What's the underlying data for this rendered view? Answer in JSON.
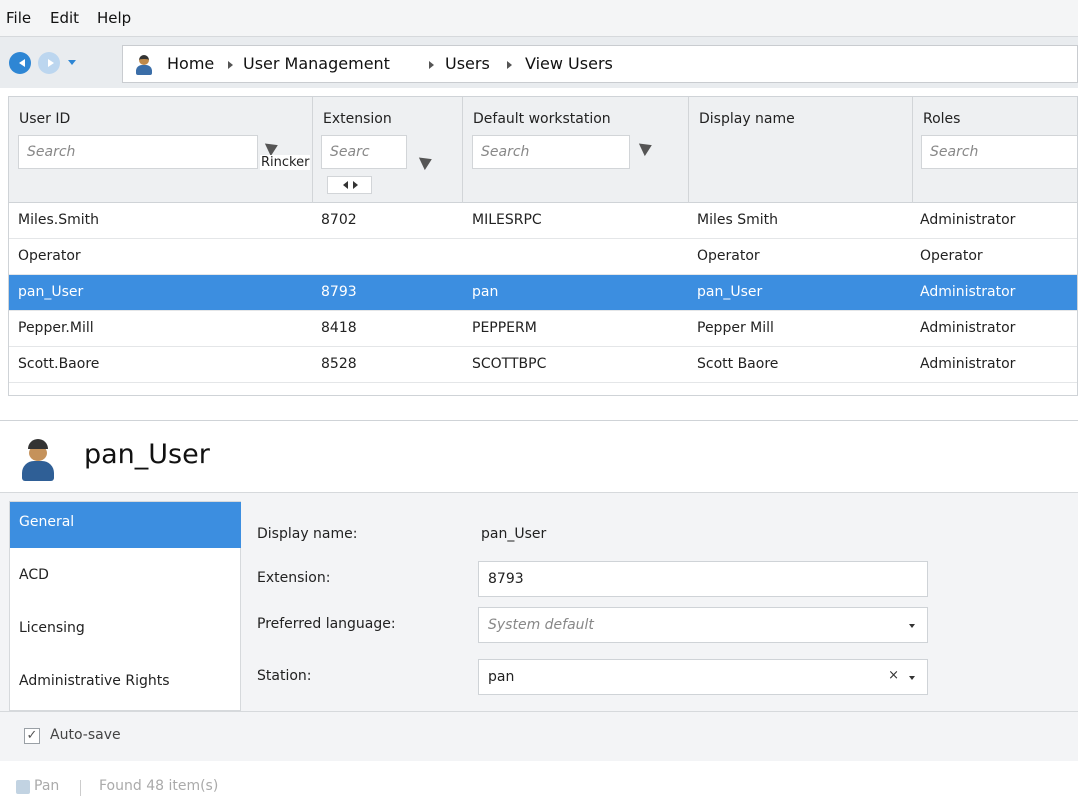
{
  "menu": [
    "File",
    "Edit",
    "Help"
  ],
  "breadcrumb": [
    "Home",
    "User Management",
    "Users",
    "View Users"
  ],
  "grid": {
    "columns": [
      {
        "title": "User ID",
        "placeholder": "Search"
      },
      {
        "title": "Extension",
        "placeholder": "Searc"
      },
      {
        "title": "Default workstation",
        "placeholder": "Search"
      },
      {
        "title": "Display name",
        "placeholder": ""
      },
      {
        "title": "Roles",
        "placeholder": "Search"
      }
    ],
    "tooltip": "Rincker",
    "rows": [
      [
        "Miles.Smith",
        "8702",
        "MILESRPC",
        "Miles Smith",
        "Administrator"
      ],
      [
        "Operator",
        "",
        "",
        "Operator",
        "Operator"
      ],
      [
        "pan_User",
        "8793",
        "pan",
        "pan_User",
        "Administrator"
      ],
      [
        "Pepper.Mill",
        "8418",
        "PEPPERM",
        "Pepper Mill",
        "Administrator"
      ],
      [
        "Scott.Baore",
        "8528",
        "SCOTTBPC",
        "Scott Baore",
        "Administrator"
      ]
    ],
    "selected_row": 2
  },
  "detail": {
    "title": "pan_User",
    "tabs": [
      "General",
      "ACD",
      "Licensing",
      "Administrative Rights"
    ],
    "active_tab": 0,
    "fields": {
      "display_name_label": "Display name:",
      "display_name_value": "pan_User",
      "extension_label": "Extension:",
      "extension_value": "8793",
      "language_label": "Preferred language:",
      "language_placeholder": "System default",
      "station_label": "Station:",
      "station_value": "pan",
      "clear_glyph": "×"
    },
    "autosave_label": "Auto-save",
    "autosave_checked": true
  },
  "status": {
    "user": "Pan",
    "count_text": "Found 48 item(s)"
  }
}
